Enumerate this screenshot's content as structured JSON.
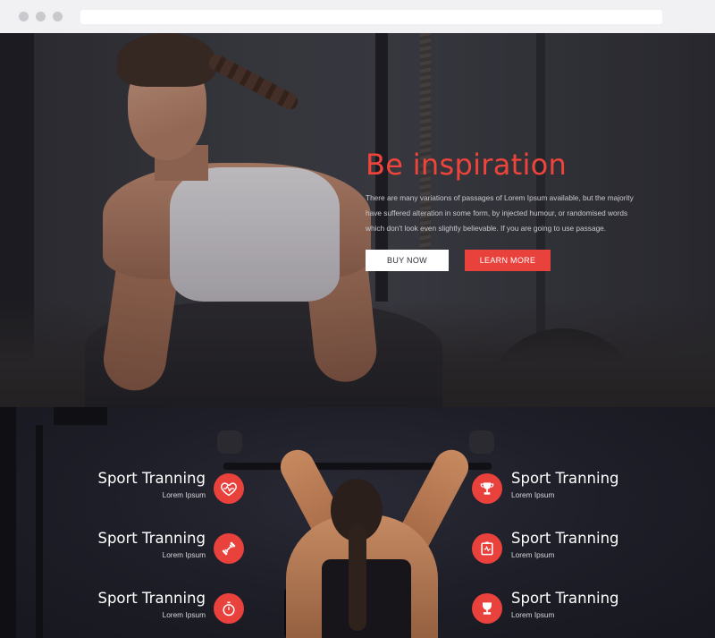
{
  "hero": {
    "title": "Be inspiration",
    "text": "There are many variations of passages of Lorem Ipsum available, but the majority have suffered alteration in some form, by injected humour, or randomised words which don't look even slightly believable. If you are going to use passage.",
    "buy_label": "BUY NOW",
    "learn_label": "LEARN MORE"
  },
  "features": {
    "left": [
      {
        "title": "Sport Tranning",
        "subtitle": "Lorem Ipsum",
        "icon": "heart-pulse-icon"
      },
      {
        "title": "Sport Tranning",
        "subtitle": "Lorem Ipsum",
        "icon": "dumbbell-icon"
      },
      {
        "title": "Sport Tranning",
        "subtitle": "Lorem Ipsum",
        "icon": "stopwatch-icon"
      }
    ],
    "right": [
      {
        "title": "Sport Tranning",
        "subtitle": "Lorem Ipsum",
        "icon": "trophy-cup-icon"
      },
      {
        "title": "Sport Tranning",
        "subtitle": "Lorem Ipsum",
        "icon": "scale-monitor-icon"
      },
      {
        "title": "Sport Tranning",
        "subtitle": "Lorem Ipsum",
        "icon": "trophy-icon"
      }
    ]
  },
  "colors": {
    "accent": "#e9413c",
    "hero_title": "#f0433a",
    "button_light": "#ffffff"
  }
}
